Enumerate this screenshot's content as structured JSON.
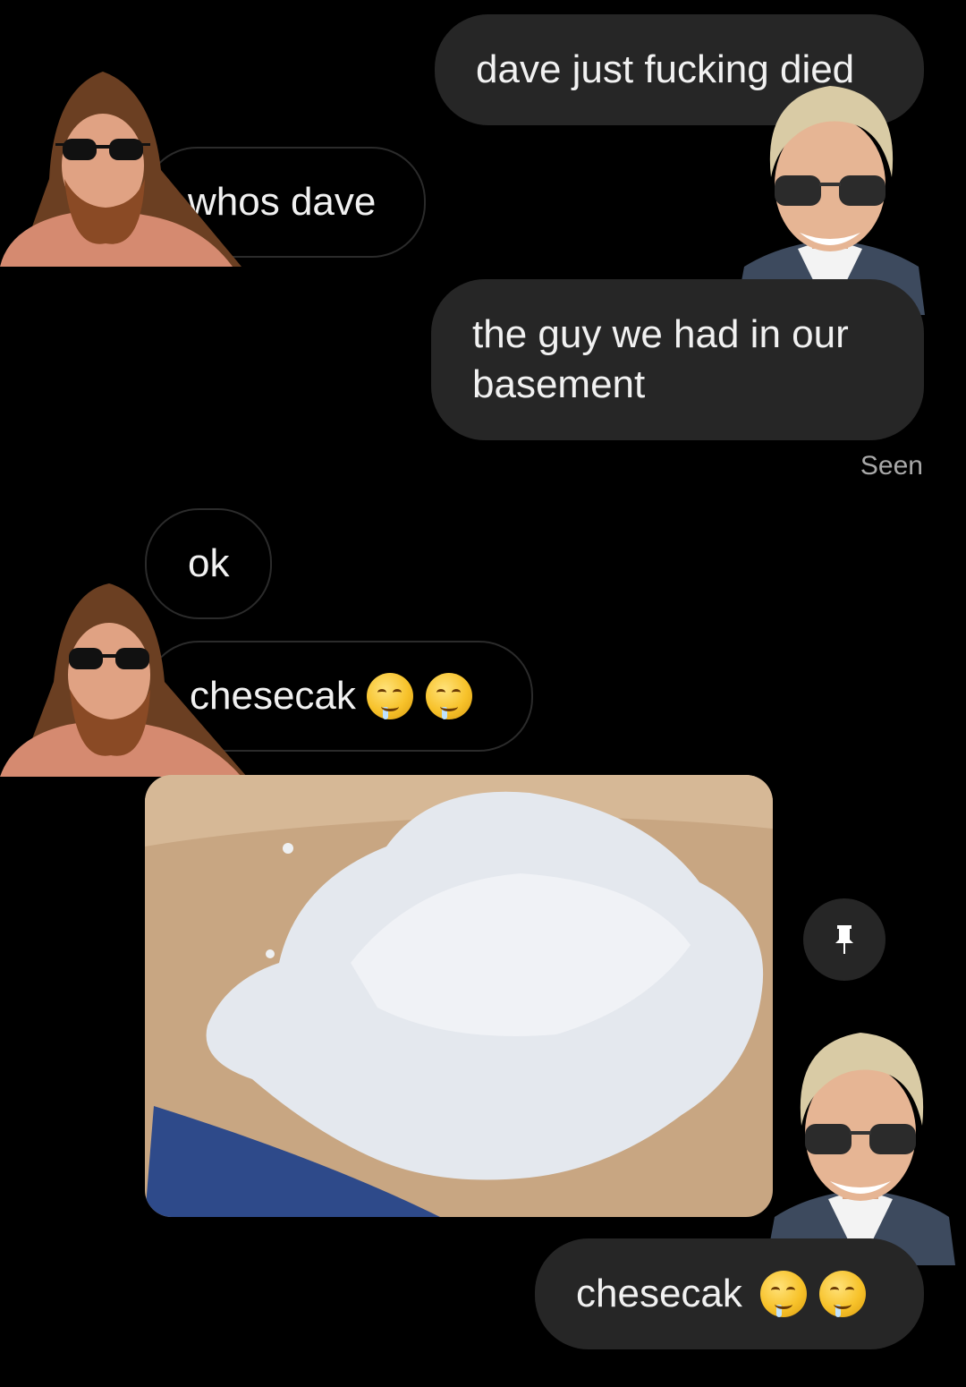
{
  "messages": [
    {
      "id": "m1",
      "direction": "outgoing",
      "text": "dave just fucking died"
    },
    {
      "id": "m2",
      "direction": "incoming",
      "text": "whos dave"
    },
    {
      "id": "m3",
      "direction": "outgoing",
      "text": "the guy we had in our basement"
    },
    {
      "id": "m4",
      "direction": "incoming",
      "text": "ok"
    },
    {
      "id": "m5",
      "direction": "incoming",
      "text": "chesecak",
      "emojis": [
        "drooling-face",
        "drooling-face"
      ]
    },
    {
      "id": "m6",
      "direction": "incoming",
      "type": "photo",
      "description_icon": "cheesecake-photo"
    },
    {
      "id": "m7",
      "direction": "outgoing",
      "text": "chesecak",
      "emojis": [
        "drooling-face",
        "drooling-face"
      ]
    }
  ],
  "status": {
    "seen_label": "Seen"
  },
  "icons": {
    "pin": "pin-icon",
    "emoji": "drooling-face-emoji"
  },
  "colors": {
    "background": "#000000",
    "outgoing_bubble": "#262626",
    "incoming_border": "#2b2b2b",
    "text": "#f1f1f1",
    "seen": "#a8a8a8"
  }
}
